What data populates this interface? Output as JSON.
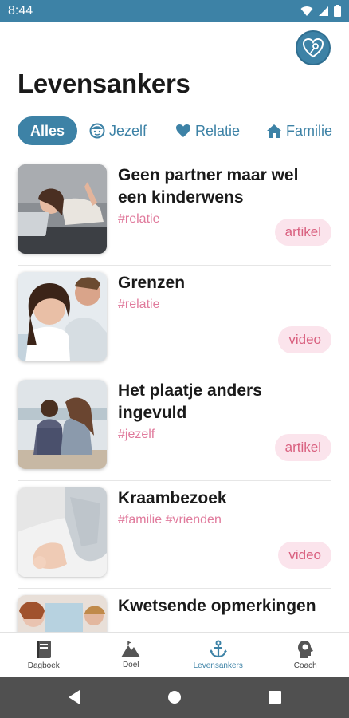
{
  "status": {
    "time": "8:44"
  },
  "header": {
    "title": "Levensankers"
  },
  "filters": [
    {
      "label": "Alles",
      "icon": "none",
      "active": true
    },
    {
      "label": "Jezelf",
      "icon": "face-icon"
    },
    {
      "label": "Relatie",
      "icon": "heart-icon"
    },
    {
      "label": "Familie",
      "icon": "home-icon"
    }
  ],
  "items": [
    {
      "title": "Geen partner maar wel een kinderwens",
      "tags": "#relatie",
      "type": "artikel"
    },
    {
      "title": "Grenzen",
      "tags": "#relatie",
      "type": "video"
    },
    {
      "title": "Het plaatje anders ingevuld",
      "tags": "#jezelf",
      "type": "artikel"
    },
    {
      "title": "Kraambezoek",
      "tags": "#familie #vrienden",
      "type": "video"
    },
    {
      "title": "Kwetsende opmerkingen",
      "tags": "",
      "type": ""
    }
  ],
  "nav": [
    {
      "label": "Dagboek",
      "icon": "diary-icon"
    },
    {
      "label": "Doel",
      "icon": "mountain-icon"
    },
    {
      "label": "Levensankers",
      "icon": "anchor-icon",
      "active": true
    },
    {
      "label": "Coach",
      "icon": "lightbulb-head-icon"
    }
  ],
  "colors": {
    "primary": "#3d82a6",
    "tag": "#e07a9c",
    "badge_bg": "#fbe4ec",
    "badge_text": "#d9607f"
  }
}
